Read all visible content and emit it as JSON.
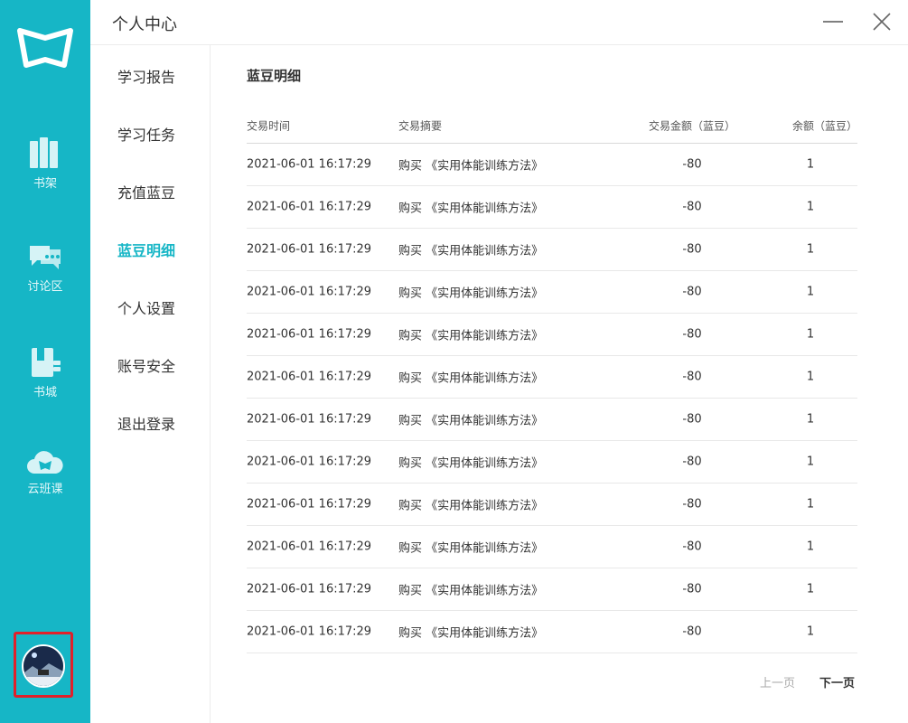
{
  "header": {
    "title": "个人中心"
  },
  "rail": {
    "items": [
      {
        "label": "书架",
        "icon": "bookshelf-icon"
      },
      {
        "label": "讨论区",
        "icon": "chat-icon"
      },
      {
        "label": "书城",
        "icon": "book-store-icon"
      },
      {
        "label": "云班课",
        "icon": "cloud-class-icon"
      }
    ]
  },
  "subnav": {
    "items": [
      {
        "label": "学习报告"
      },
      {
        "label": "学习任务"
      },
      {
        "label": "充值蓝豆"
      },
      {
        "label": "蓝豆明细",
        "active": true
      },
      {
        "label": "个人设置"
      },
      {
        "label": "账号安全"
      },
      {
        "label": "退出登录"
      }
    ]
  },
  "main": {
    "title": "蓝豆明细",
    "columns": [
      "交易时间",
      "交易摘要",
      "交易金额（蓝豆）",
      "余额（蓝豆）"
    ],
    "rows": [
      [
        "2021-06-01 16:17:29",
        "购买 《实用体能训练方法》",
        "-80",
        "1"
      ],
      [
        "2021-06-01 16:17:29",
        "购买 《实用体能训练方法》",
        "-80",
        "1"
      ],
      [
        "2021-06-01 16:17:29",
        "购买 《实用体能训练方法》",
        "-80",
        "1"
      ],
      [
        "2021-06-01 16:17:29",
        "购买 《实用体能训练方法》",
        "-80",
        "1"
      ],
      [
        "2021-06-01 16:17:29",
        "购买 《实用体能训练方法》",
        "-80",
        "1"
      ],
      [
        "2021-06-01 16:17:29",
        "购买 《实用体能训练方法》",
        "-80",
        "1"
      ],
      [
        "2021-06-01 16:17:29",
        "购买 《实用体能训练方法》",
        "-80",
        "1"
      ],
      [
        "2021-06-01 16:17:29",
        "购买 《实用体能训练方法》",
        "-80",
        "1"
      ],
      [
        "2021-06-01 16:17:29",
        "购买 《实用体能训练方法》",
        "-80",
        "1"
      ],
      [
        "2021-06-01 16:17:29",
        "购买 《实用体能训练方法》",
        "-80",
        "1"
      ],
      [
        "2021-06-01 16:17:29",
        "购买 《实用体能训练方法》",
        "-80",
        "1"
      ],
      [
        "2021-06-01 16:17:29",
        "购买 《实用体能训练方法》",
        "-80",
        "1"
      ]
    ],
    "pager": {
      "prev": "上一页",
      "next": "下一页"
    }
  },
  "colors": {
    "accent": "#16b6c6",
    "highlight": "#e0202a"
  }
}
